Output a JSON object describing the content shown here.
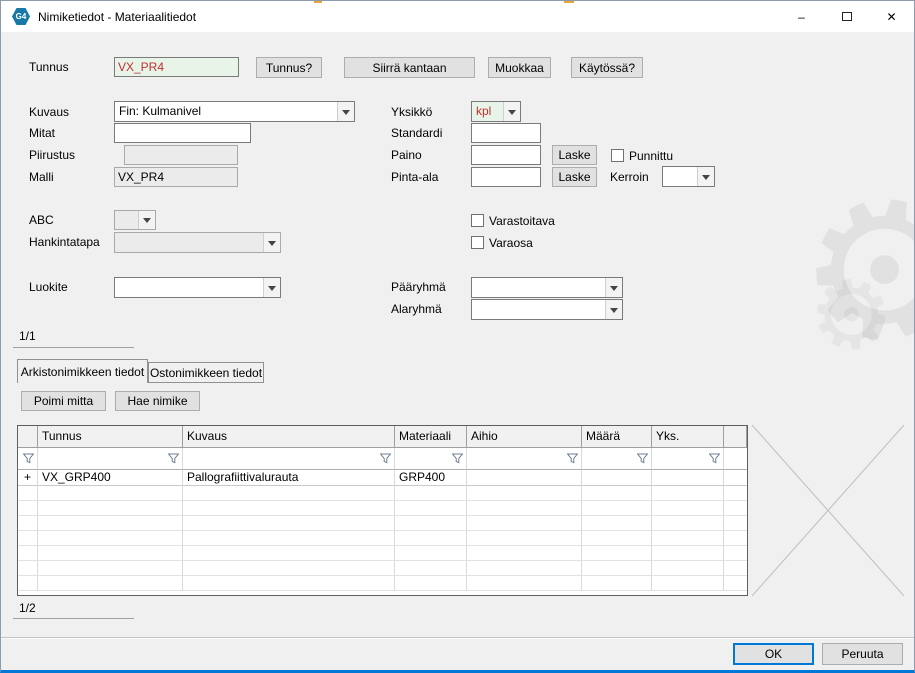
{
  "window": {
    "title": "Nimiketiedot - Materiaalitiedot",
    "icon_label": "G4"
  },
  "icons": {
    "minimize": "–",
    "close": "✕",
    "gear": "⚙"
  },
  "colors": {
    "accent": "#0078d7",
    "value_text": "#c03030",
    "value_field_bg": "#e9f4e9"
  },
  "form": {
    "tunnus": {
      "label": "Tunnus",
      "value": "VX_PR4"
    },
    "action_buttons": [
      "Tunnus?",
      "Siirrä kantaan",
      "Muokkaa",
      "Käytössä?"
    ],
    "kuvaus": {
      "label": "Kuvaus",
      "value": "Fin: Kulmanivel"
    },
    "yksikko": {
      "label": "Yksikkö",
      "value": "kpl"
    },
    "mitat": {
      "label": "Mitat",
      "value": ""
    },
    "standardi": {
      "label": "Standardi",
      "value": ""
    },
    "piirustus": {
      "label": "Piirustus",
      "value": ""
    },
    "paino": {
      "label": "Paino",
      "value": ""
    },
    "laske_label": "Laske",
    "punnittu_label": "Punnittu",
    "malli": {
      "label": "Malli",
      "value": "VX_PR4"
    },
    "pinta_ala": {
      "label": "Pinta-ala",
      "value": ""
    },
    "kerroin_label": "Kerroin",
    "abc_label": "ABC",
    "hankintatapa_label": "Hankintatapa",
    "varastoitava_label": "Varastoitava",
    "varaosa_label": "Varaosa",
    "luokite_label": "Luokite",
    "paaryhma_label": "Pääryhmä",
    "alaryhma_label": "Alaryhmä",
    "pager": "1/1"
  },
  "tabs": [
    {
      "label": "Arkistonimikkeen tiedot",
      "active": true
    },
    {
      "label": "Ostonimikkeen tiedot",
      "active": false
    }
  ],
  "toolbar": {
    "poimi_mitta": "Poimi mitta",
    "hae_nimike": "Hae nimike"
  },
  "grid": {
    "columns": [
      "Tunnus",
      "Kuvaus",
      "Materiaali",
      "Aihio",
      "Määrä",
      "Yks."
    ],
    "rows": [
      [
        "+",
        "VX_GRP400",
        "Pallografiittivalurauta",
        "GRP400",
        "",
        "",
        ""
      ]
    ],
    "pager": "1/2"
  },
  "footer": {
    "ok_label": "OK",
    "cancel_label": "Peruuta"
  }
}
